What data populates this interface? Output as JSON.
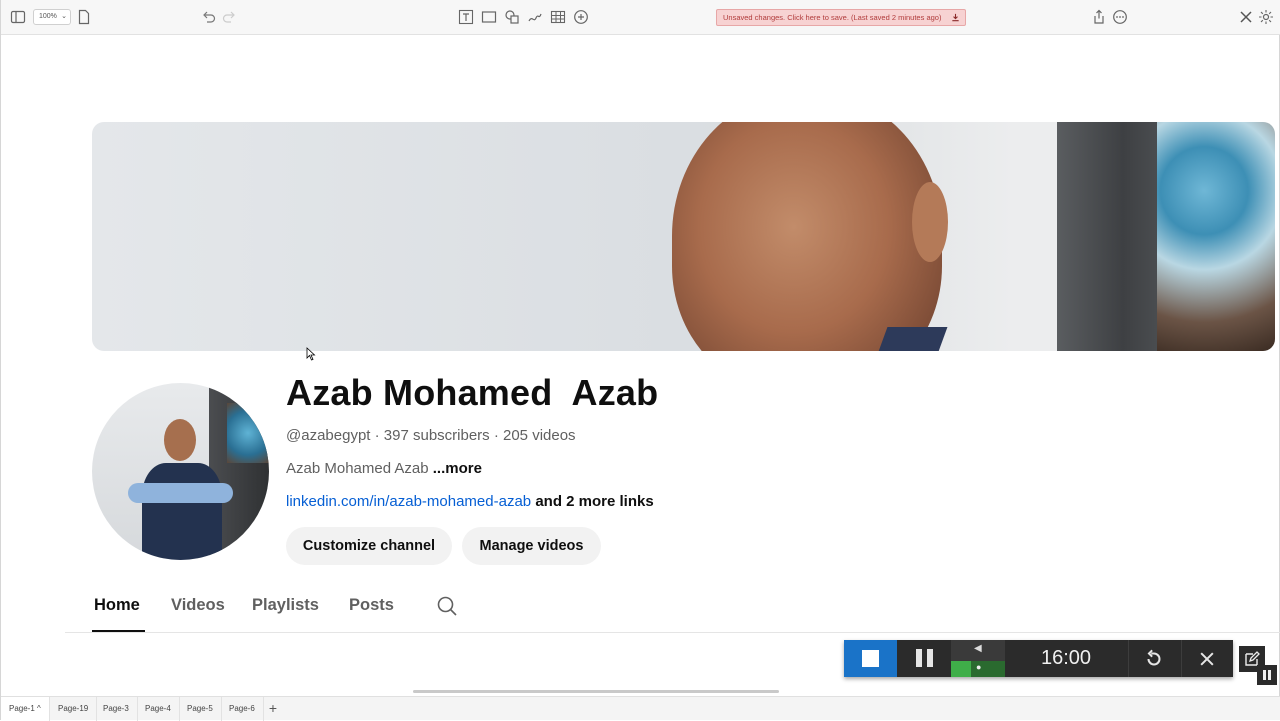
{
  "toolbar": {
    "zoom_value": "100%",
    "save_banner": "Unsaved changes. Click here to save. (Last saved 2 minutes ago)",
    "icons": [
      "sidebar-toggle-icon",
      "page-icon",
      "undo-icon",
      "redo-icon",
      "text-frame-icon",
      "rectangle-icon",
      "shapes-icon",
      "freehand-icon",
      "table-icon",
      "insert-icon",
      "download-icon",
      "share-icon",
      "more-icon",
      "tools-icon",
      "settings-icon"
    ]
  },
  "channel": {
    "name": "Azab Mohamed  Azab",
    "meta": "@azabegypt · 397 subscribers · 205 videos",
    "description": "Azab Mohamed Azab",
    "more_label": "...more",
    "link": "linkedin.com/in/azab-mohamed-azab",
    "more_links": "and 2 more links",
    "customize_label": "Customize channel",
    "manage_label": "Manage videos"
  },
  "tabs": {
    "items": [
      "Home",
      "Videos",
      "Playlists",
      "Posts"
    ],
    "active": "Home"
  },
  "recorder": {
    "time": "16:00",
    "stop_color": "#1a73c8"
  },
  "pages": {
    "items": [
      "Page-1",
      "Page-19",
      "Page-3",
      "Page-4",
      "Page-5",
      "Page-6"
    ],
    "active_marker": "^",
    "add_label": "+"
  }
}
